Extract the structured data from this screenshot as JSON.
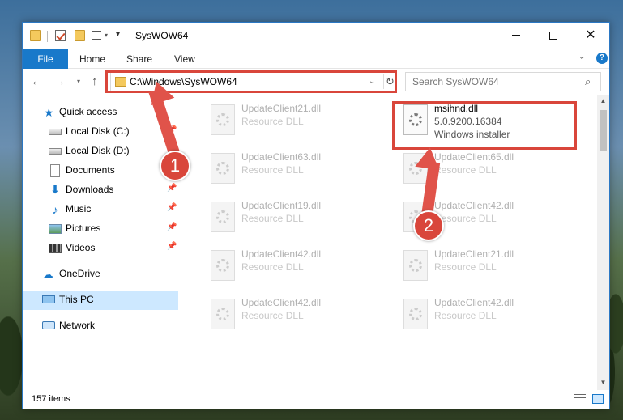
{
  "window": {
    "title": "SysWOW64",
    "controls": {
      "minimize": "",
      "maximize": "",
      "close": "✕"
    }
  },
  "ribbon": {
    "tabs": [
      "File",
      "Home",
      "Share",
      "View"
    ],
    "chevron": "⌄",
    "help": "?"
  },
  "navigation": {
    "back": "←",
    "forward": "→",
    "recent": "▾",
    "up": "↑",
    "address": "C:\\Windows\\SysWOW64",
    "address_dropdown": "⌄",
    "refresh": "↻",
    "search_placeholder": "Search SysWOW64",
    "search_icon": "⌕"
  },
  "sidebar": {
    "items": [
      {
        "label": "Quick access",
        "icon": "star-icon",
        "pinned": false
      },
      {
        "label": "Local Disk (C:)",
        "icon": "drive-icon",
        "pinned": true
      },
      {
        "label": "Local Disk (D:)",
        "icon": "drive-icon",
        "pinned": false
      },
      {
        "label": "Documents",
        "icon": "documents-icon",
        "pinned": true
      },
      {
        "label": "Downloads",
        "icon": "download-icon",
        "pinned": true
      },
      {
        "label": "Music",
        "icon": "music-icon",
        "pinned": true
      },
      {
        "label": "Pictures",
        "icon": "pictures-icon",
        "pinned": true
      },
      {
        "label": "Videos",
        "icon": "videos-icon",
        "pinned": true
      },
      {
        "label": "OneDrive",
        "icon": "cloud-icon",
        "pinned": false
      },
      {
        "label": "This PC",
        "icon": "computer-icon",
        "pinned": false,
        "selected": true
      },
      {
        "label": "Network",
        "icon": "network-icon",
        "pinned": false
      }
    ],
    "pin_glyph": "📌"
  },
  "files": {
    "left_column": [
      {
        "name": "UpdateClient21.dll",
        "type": "Resource DLL"
      },
      {
        "name": "UpdateClient63.dll",
        "type": "Resource DLL"
      },
      {
        "name": "UpdateClient19.dll",
        "type": "Resource DLL"
      },
      {
        "name": "UpdateClient42.dll",
        "type": "Resource DLL"
      },
      {
        "name": "UpdateClient42.dll",
        "type": "Resource DLL"
      }
    ],
    "featured": {
      "name": "msihnd.dll",
      "version": "5.0.9200.16384",
      "type": "Windows installer"
    },
    "right_column": [
      {
        "name": "UpdateClient65.dll",
        "type": "Resource DLL"
      },
      {
        "name": "UpdateClient42.dll",
        "type": "Resource DLL"
      },
      {
        "name": "UpdateClient21.dll",
        "type": "Resource DLL"
      },
      {
        "name": "UpdateClient42.dll",
        "type": "Resource DLL"
      }
    ]
  },
  "status": {
    "item_count": "157 items"
  },
  "annotations": {
    "step1": "1",
    "step2": "2"
  },
  "colors": {
    "accent": "#1979ca",
    "highlight": "#d9463b"
  }
}
